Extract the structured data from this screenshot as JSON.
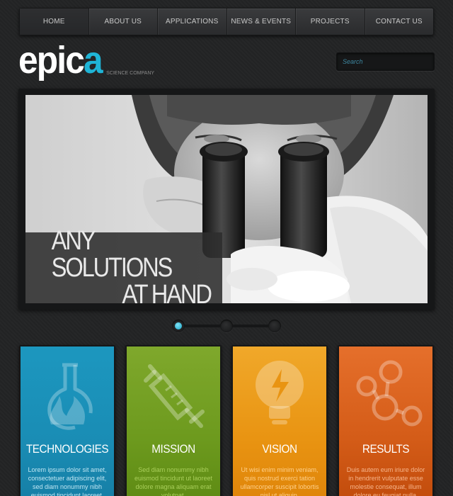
{
  "nav": {
    "items": [
      {
        "label": "HOME"
      },
      {
        "label": "ABOUT US"
      },
      {
        "label": "APPLICATIONS"
      },
      {
        "label": "NEWS & EVENTS"
      },
      {
        "label": "PROJECTS"
      },
      {
        "label": "CONTACT US"
      }
    ],
    "active_index": 0
  },
  "logo": {
    "word_main": "epic",
    "word_accent": "a",
    "tagline": "SCIENCE COMPANY"
  },
  "search": {
    "placeholder": "Search"
  },
  "slider": {
    "caption_line1": "ANY SOLUTIONS",
    "caption_line2": "AT HAND",
    "image_subject": "woman-looking-into-microscope",
    "total_slides": 3,
    "active_slide": 1
  },
  "cards": [
    {
      "title": "TECHNOLOGIES",
      "icon": "flask-flame-icon",
      "color": "#1a8db5",
      "text": "Lorem ipsum dolor sit amet, consectetuer adipiscing elit, sed diam nonummy nibh euismod tincidunt laoreet."
    },
    {
      "title": "MISSION",
      "icon": "syringe-icon",
      "color": "#6d9a1e",
      "text": "Sed diam nonummy nibh euismod tincidunt ut laoreet dolore magna aliquam erat volutpat."
    },
    {
      "title": "VISION",
      "icon": "lightbulb-bolt-icon",
      "color": "#e99412",
      "text": "Ut wisi enim minim veniam, quis nostrud exerci tation ullamcorper suscipit lobortis nisl ut aliquip."
    },
    {
      "title": "RESULTS",
      "icon": "molecule-icon",
      "color": "#d45c18",
      "text": "Duis autem eum iriure dolor in hendrerit vulputate esse molestie consequat, illum dolore eu feugiat nulla."
    }
  ],
  "colors": {
    "accent": "#1fb4d6",
    "background": "#232425"
  }
}
